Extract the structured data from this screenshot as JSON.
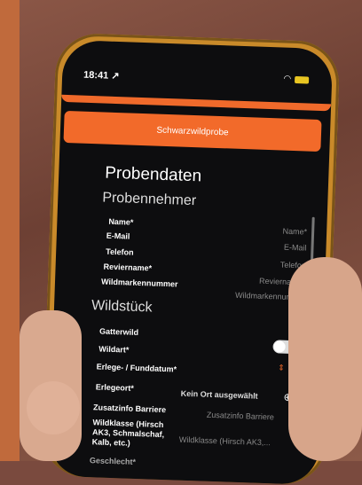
{
  "status": {
    "time": "18:41",
    "location_arrow": "↗"
  },
  "actions": {
    "primary": "Schwarzwildprobe"
  },
  "form": {
    "title": "Probendaten",
    "sections": {
      "probennehmer": "Probennehmer",
      "wildstueck": "Wildstück"
    },
    "fields": {
      "name": {
        "label": "Name*",
        "placeholder": "Name*"
      },
      "email": {
        "label": "E-Mail",
        "placeholder": "E-Mail"
      },
      "telefon": {
        "label": "Telefon",
        "placeholder": "Telefon"
      },
      "reviername": {
        "label": "Reviername*",
        "placeholder": "Reviername*"
      },
      "wildmarken": {
        "label": "Wildmarkennummer",
        "placeholder": "Wildmarkennummer"
      },
      "gatterwild": {
        "label": "Gatterwild"
      },
      "wildart": {
        "label": "Wildart*"
      },
      "erlegedatum": {
        "label": "Erlege- / Funddatum*"
      },
      "erlegeort": {
        "label": "Erlegeort*",
        "value": "Kein Ort ausgewählt"
      },
      "zusatzinfo": {
        "label": "Zusatzinfo Barriere",
        "placeholder": "Zusatzinfo Barriere"
      },
      "wildklasse": {
        "label": "Wildklasse (Hirsch AK3, Schmalschaf, Kalb, etc.)",
        "placeholder": "Wildklasse (Hirsch AK3,..."
      },
      "geschlecht": {
        "label": "Geschlecht*"
      }
    }
  },
  "colors": {
    "accent": "#f26a2a",
    "screen_bg": "#0d0d0f",
    "battery": "#e8c522"
  },
  "icons": {
    "wifi": "wifi-icon",
    "battery": "battery-icon",
    "zoom": "zoom-icon",
    "stepper": "chevron-up-down-icon"
  }
}
